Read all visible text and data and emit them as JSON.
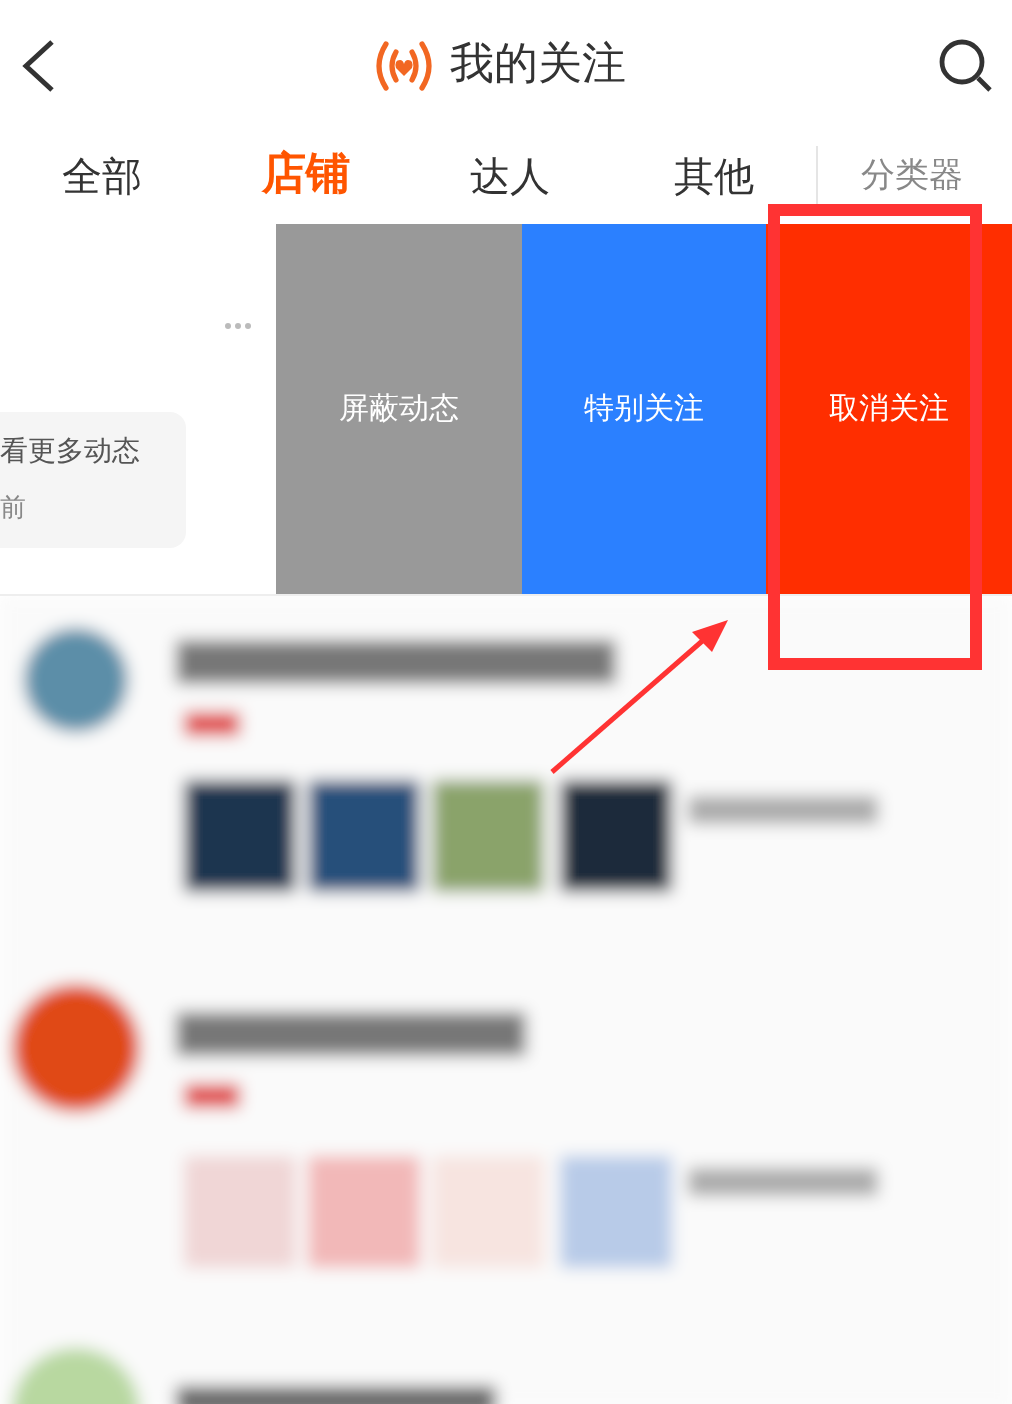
{
  "header": {
    "title": "我的关注"
  },
  "tabs": [
    {
      "label": "全部",
      "selected": false
    },
    {
      "label": "店铺",
      "selected": true
    },
    {
      "label": "达人",
      "selected": false
    },
    {
      "label": "其他",
      "selected": false
    },
    {
      "label": "分类器",
      "selected": false
    }
  ],
  "swiped_item": {
    "more_text": "看更多动态",
    "time": "前",
    "actions": [
      {
        "label": "屏蔽动态",
        "kind": "hide"
      },
      {
        "label": "特别关注",
        "kind": "special"
      },
      {
        "label": "取消关注",
        "kind": "unfollow"
      }
    ]
  }
}
